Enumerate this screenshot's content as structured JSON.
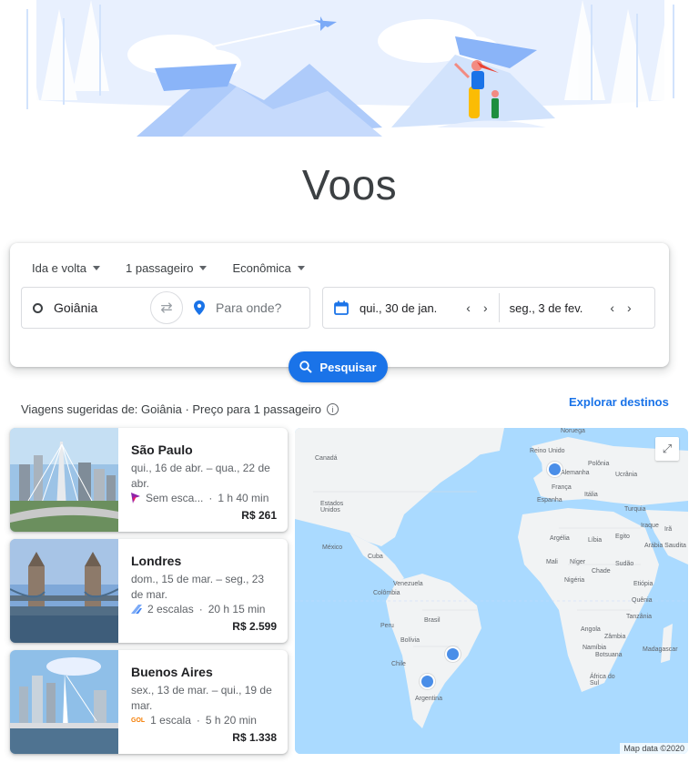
{
  "page": {
    "title": "Voos"
  },
  "search": {
    "trip_type": "Ida e volta",
    "passengers": "1 passageiro",
    "cabin": "Econômica",
    "origin": "Goiânia",
    "destination_placeholder": "Para onde?",
    "depart_date": "qui., 30 de jan.",
    "return_date": "seg., 3 de fev.",
    "search_button": "Pesquisar"
  },
  "suggestions": {
    "heading": "Viagens sugeridas de: Goiânia · Preço para 1 passageiro",
    "explore_link": "Explorar destinos",
    "trips": [
      {
        "city": "São Paulo",
        "dates": "qui., 16 de abr. – qua., 22 de abr.",
        "stops": "Sem esca...",
        "duration": "1 h 40 min",
        "price": "R$ 261"
      },
      {
        "city": "Londres",
        "dates": "dom., 15 de mar. – seg., 23 de mar.",
        "stops": "2 escalas",
        "duration": "20 h 15 min",
        "price": "R$ 2.599"
      },
      {
        "city": "Buenos Aires",
        "dates": "sex., 13 de mar. – qui., 19 de mar.",
        "stops": "1 escala",
        "duration": "5 h 20 min",
        "price": "R$ 1.338"
      }
    ]
  },
  "map": {
    "credit": "Map data ©2020",
    "labels": [
      "Noruega",
      "Reino Unido",
      "Polônia",
      "Alemanha",
      "Ucrânia",
      "França",
      "Itália",
      "Espanha",
      "Turquia",
      "Iraque",
      "Irã",
      "Argélia",
      "Líbia",
      "Egito",
      "Arábia Saudita",
      "Mali",
      "Níger",
      "Chade",
      "Sudão",
      "Nigéria",
      "Etiópia",
      "Quênia",
      "Tanzânia",
      "Angola",
      "Zâmbia",
      "Namíbia",
      "Botsuana",
      "Madagascar",
      "África do Sul",
      "Canadá",
      "Estados Unidos",
      "México",
      "Cuba",
      "Venezuela",
      "Colômbia",
      "Peru",
      "Brasil",
      "Bolívia",
      "Chile",
      "Argentina"
    ]
  },
  "colors": {
    "accent": "#1a73e8",
    "marker": "#4a8ee8",
    "ocean": "#aadaff",
    "land": "#f2f2f2"
  }
}
